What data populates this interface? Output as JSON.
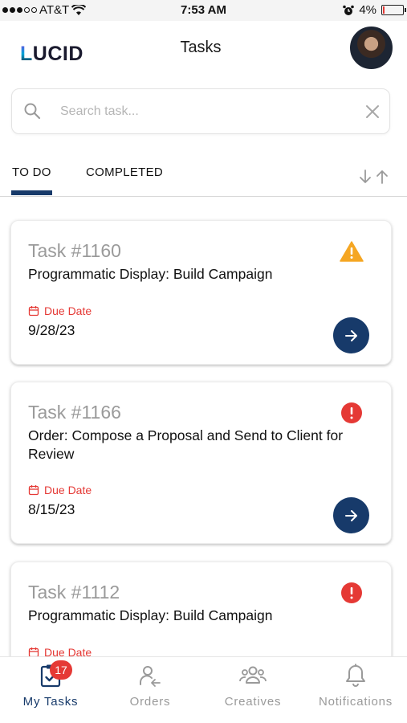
{
  "status_bar": {
    "carrier": "AT&T",
    "time": "7:53 AM",
    "battery": "4%"
  },
  "header": {
    "logo_text": "LUCID",
    "title": "Tasks"
  },
  "search": {
    "placeholder": "Search task..."
  },
  "tabs": [
    {
      "label": "TO DO",
      "active": true
    },
    {
      "label": "COMPLETED",
      "active": false
    }
  ],
  "tasks": [
    {
      "number": "Task #1160",
      "title": "Programmatic Display: Build Campaign",
      "due_label": "Due Date",
      "due_date": "9/28/23",
      "status_icon": "warning-icon",
      "status_color": "#f5a623"
    },
    {
      "number": "Task #1166",
      "title": "Order: Compose a Proposal and Send to Client for Review",
      "due_label": "Due Date",
      "due_date": "8/15/23",
      "status_icon": "alert-icon",
      "status_color": "#e53935"
    },
    {
      "number": "Task #1112",
      "title": "Programmatic Display: Build Campaign",
      "due_label": "Due Date",
      "status_icon": "alert-icon",
      "status_color": "#e53935"
    }
  ],
  "bottom_nav": [
    {
      "label": "My Tasks",
      "icon": "clipboard-check-icon",
      "badge": "17",
      "active": true
    },
    {
      "label": "Orders",
      "icon": "user-arrow-icon",
      "active": false
    },
    {
      "label": "Creatives",
      "icon": "group-icon",
      "active": false
    },
    {
      "label": "Notifications",
      "icon": "bell-icon",
      "active": false
    }
  ],
  "colors": {
    "primary": "#173a6a",
    "danger": "#e53935",
    "warning": "#f5a623",
    "muted": "#9a9a9a"
  }
}
